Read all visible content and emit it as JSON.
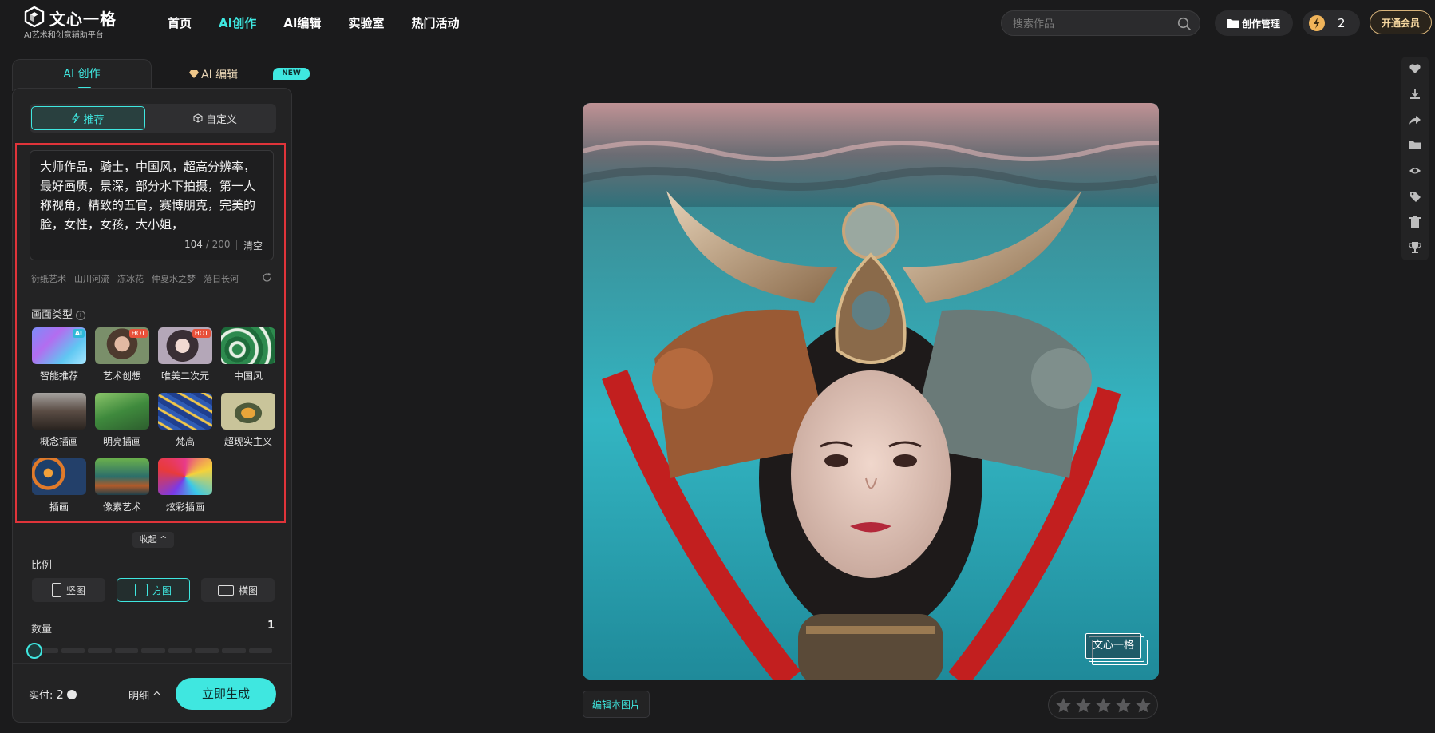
{
  "header": {
    "logo_name": "文心一格",
    "logo_sub": "AI艺术和创意辅助平台",
    "nav": [
      "首页",
      "AI创作",
      "AI编辑",
      "实验室",
      "热门活动"
    ],
    "active_nav": "AI创作",
    "search_placeholder": "搜索作品",
    "manage_label": "创作管理",
    "credits": "2",
    "vip_label": "开通会员"
  },
  "panel": {
    "tab_create": "AI 创作",
    "tab_edit": "AI 编辑",
    "new_badge": "NEW",
    "mode_recommend": "推荐",
    "mode_custom": "自定义",
    "prompt": "大师作品，骑士，中国风，超高分辨率，最好画质，景深，部分水下拍摄，第一人称视角，精致的五官，赛博朋克，完美的脸，女性，女孩，大小姐，",
    "prompt_count": "104",
    "prompt_max": "/ 200",
    "clear_label": "清空",
    "suggestions": [
      "衍纸艺术",
      "山川河流",
      "冻冰花",
      "仲夏水之梦",
      "落日长河"
    ],
    "style_title": "画面类型",
    "styles": [
      {
        "label": "智能推荐",
        "badge": "AI"
      },
      {
        "label": "艺术创想",
        "badge": "HOT"
      },
      {
        "label": "唯美二次元",
        "badge": "HOT"
      },
      {
        "label": "中国风",
        "badge": ""
      },
      {
        "label": "概念插画",
        "badge": ""
      },
      {
        "label": "明亮插画",
        "badge": ""
      },
      {
        "label": "梵高",
        "badge": ""
      },
      {
        "label": "超现实主义",
        "badge": ""
      },
      {
        "label": "插画",
        "badge": ""
      },
      {
        "label": "像素艺术",
        "badge": ""
      },
      {
        "label": "炫彩插画",
        "badge": ""
      }
    ],
    "collapse_label": "收起",
    "ratio_title": "比例",
    "ratios": [
      "竖图",
      "方图",
      "横图"
    ],
    "ratio_selected": "方图",
    "quantity_title": "数量",
    "quantity_value": "1",
    "cost_label": "实付:",
    "cost_value": "2",
    "detail_label": "明细",
    "generate_label": "立即生成"
  },
  "result": {
    "watermark": "文心一格",
    "edit_button": "编辑本图片",
    "rating_stars": 5,
    "rating_value": 0
  },
  "rail": {
    "icons": [
      "heart-icon",
      "download-icon",
      "share-icon",
      "folder-icon",
      "eye-icon",
      "tag-icon",
      "trash-icon",
      "trophy-icon"
    ]
  },
  "colors": {
    "accent": "#3fe7e0",
    "highlight_border": "#e0343a",
    "background": "#1b1b1c"
  }
}
